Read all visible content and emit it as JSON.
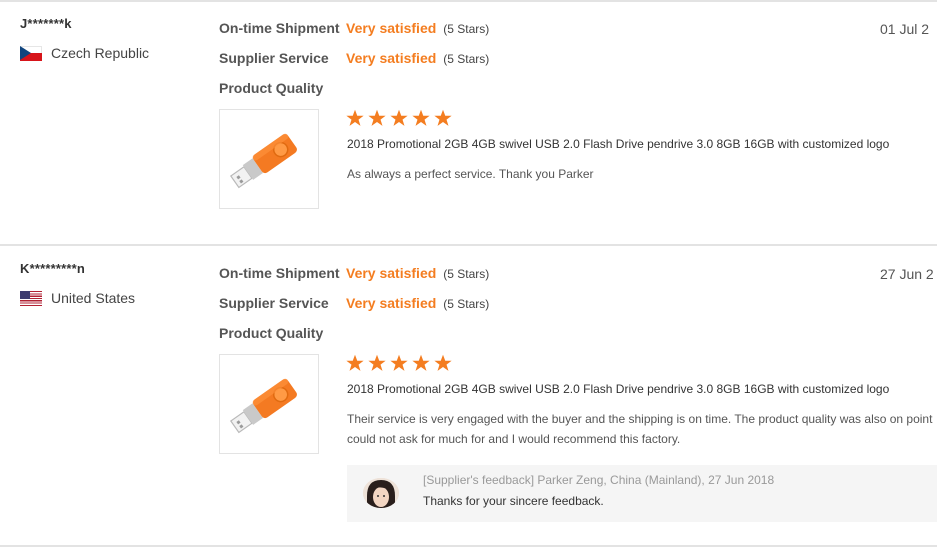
{
  "accent_color": "#f47d20",
  "reviews": [
    {
      "buyer": "J*******k",
      "country": "Czech Republic",
      "flag_icon": "czech-flag-icon",
      "date": "01 Jul 2",
      "ratings": [
        {
          "label": "On-time Shipment",
          "value": "Very satisfied",
          "stars_text": "(5 Stars)"
        },
        {
          "label": "Supplier Service",
          "value": "Very satisfied",
          "stars_text": "(5 Stars)"
        },
        {
          "label": "Product Quality"
        }
      ],
      "product_stars": 5,
      "product_title": "2018 Promotional 2GB 4GB swivel USB 2.0 Flash Drive pendrive 3.0 8GB 16GB with customized logo",
      "comment_line1": "As always a perfect service. Thank you Parker",
      "comment_line2": ""
    },
    {
      "buyer": "K*********n",
      "country": "United States",
      "flag_icon": "us-flag-icon",
      "date": "27 Jun 2",
      "ratings": [
        {
          "label": "On-time Shipment",
          "value": "Very satisfied",
          "stars_text": "(5 Stars)"
        },
        {
          "label": "Supplier Service",
          "value": "Very satisfied",
          "stars_text": "(5 Stars)"
        },
        {
          "label": "Product Quality"
        }
      ],
      "product_stars": 5,
      "product_title": "2018 Promotional 2GB 4GB swivel USB 2.0 Flash Drive pendrive 3.0 8GB 16GB with customized logo",
      "comment_line1": "Their service is very engaged with the buyer and the shipping is on time. The product quality was also on point",
      "comment_line2": "could not ask for much for and I would recommend this factory.",
      "supplier_feedback": {
        "meta": "[Supplier's feedback] Parker Zeng, China (Mainland), 27 Jun 2018",
        "text": "Thanks for your sincere feedback."
      }
    }
  ]
}
